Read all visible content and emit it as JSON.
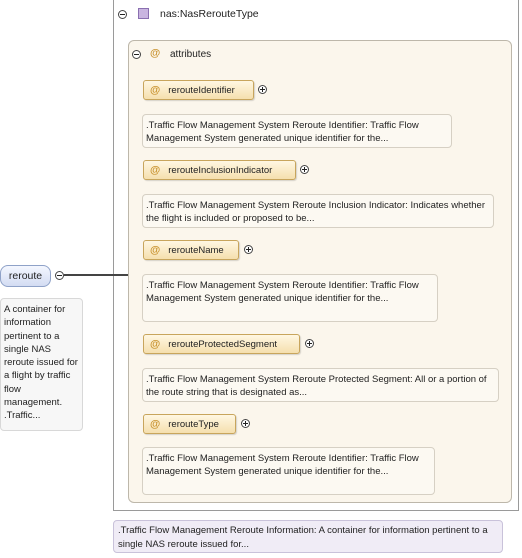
{
  "type": {
    "name": "nas:NasRerouteType"
  },
  "attributes_group": {
    "label": "attributes",
    "at_symbol": "@"
  },
  "attributes": [
    {
      "name": "rerouteIdentifier",
      "doc": ".Traffic Flow Management System Reroute Identifier: Traffic Flow Management System generated unique identifier for the..."
    },
    {
      "name": "rerouteInclusionIndicator",
      "doc": ".Traffic Flow Management System Reroute Inclusion Indicator: Indicates whether the flight is included or proposed to be..."
    },
    {
      "name": "rerouteName",
      "doc": ".Traffic Flow Management System Reroute Identifier: Traffic Flow Management System generated unique identifier for the..."
    },
    {
      "name": "rerouteProtectedSegment",
      "doc": ".Traffic Flow Management System Reroute Protected Segment: All or a portion of the route string that is designated as..."
    },
    {
      "name": "rerouteType",
      "doc": ".Traffic Flow Management System Reroute Identifier: Traffic Flow Management System generated unique identifier for the..."
    }
  ],
  "element": {
    "name": "reroute",
    "doc": "A container for information pertinent to a single NAS reroute issued for a flight by traffic flow management. .Traffic..."
  },
  "type_doc": ".Traffic Flow Management Reroute Information: A container for information pertinent to a single NAS reroute issued for..."
}
